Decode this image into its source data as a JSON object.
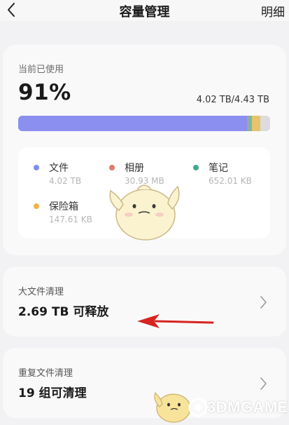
{
  "header": {
    "title": "容量管理",
    "detail_label": "明细",
    "back_icon": "chevron-left-icon"
  },
  "usage": {
    "label": "当前已使用",
    "percent": "91%",
    "total": "4.02 TB/4.43 TB",
    "bar_segments": [
      {
        "name": "文件",
        "fraction": 0.9075,
        "color": "#8b8ff0"
      },
      {
        "name": "相册",
        "fraction": 0.0067,
        "color": "#e58a75"
      },
      {
        "name": "笔记",
        "fraction": 0.0144,
        "color": "#6cbcae"
      },
      {
        "name": "保险箱",
        "fraction": 0.0325,
        "color": "#e8c36a"
      },
      {
        "name": "free",
        "fraction": 0.0389,
        "color": "#dcdcde"
      }
    ],
    "legend": [
      {
        "name": "文件",
        "value": "4.02 TB",
        "color": "#7f8de8"
      },
      {
        "name": "相册",
        "value": "30.93 MB",
        "color": "#e0796a"
      },
      {
        "name": "笔记",
        "value": "652.01 KB",
        "color": "#3fa98f"
      },
      {
        "name": "保险箱",
        "value": "147.61 KB",
        "color": "#f0b24a"
      }
    ]
  },
  "large_files": {
    "title": "大文件清理",
    "value": "2.69 TB 可释放"
  },
  "duplicates": {
    "title": "重复文件清理",
    "value": "19 组可清理"
  },
  "watermark": {
    "text": "3DMGAME"
  }
}
